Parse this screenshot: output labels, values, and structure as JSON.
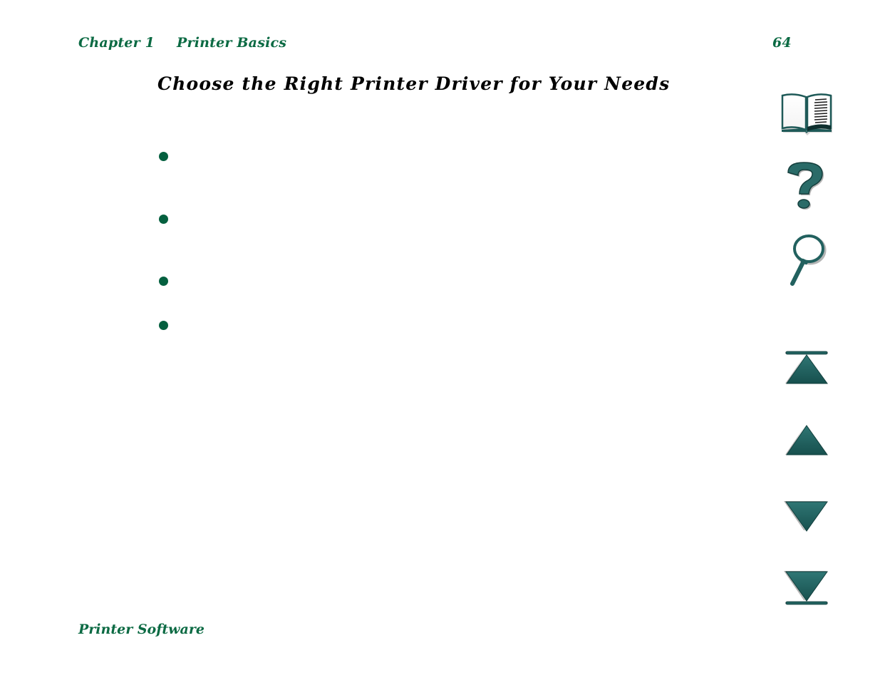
{
  "header": {
    "chapter": "Chapter 1",
    "section": "Printer Basics",
    "page_number": "64"
  },
  "page": {
    "title": "Choose the Right Printer Driver for Your Needs",
    "bullets": [
      "",
      "",
      "",
      ""
    ]
  },
  "footer": {
    "text": "Printer Software"
  },
  "nav": {
    "icons": [
      {
        "name": "contents-book-icon",
        "label": "Contents"
      },
      {
        "name": "help-question-icon",
        "label": "Help"
      },
      {
        "name": "search-magnifier-icon",
        "label": "Search"
      },
      {
        "name": "first-page-icon",
        "label": "First page"
      },
      {
        "name": "previous-page-icon",
        "label": "Previous page"
      },
      {
        "name": "next-page-icon",
        "label": "Next page"
      },
      {
        "name": "last-page-icon",
        "label": "Last page"
      }
    ]
  },
  "colors": {
    "heading_green": "#0b6a43",
    "bullet_green": "#04603f",
    "nav_teal": "#22615f"
  }
}
